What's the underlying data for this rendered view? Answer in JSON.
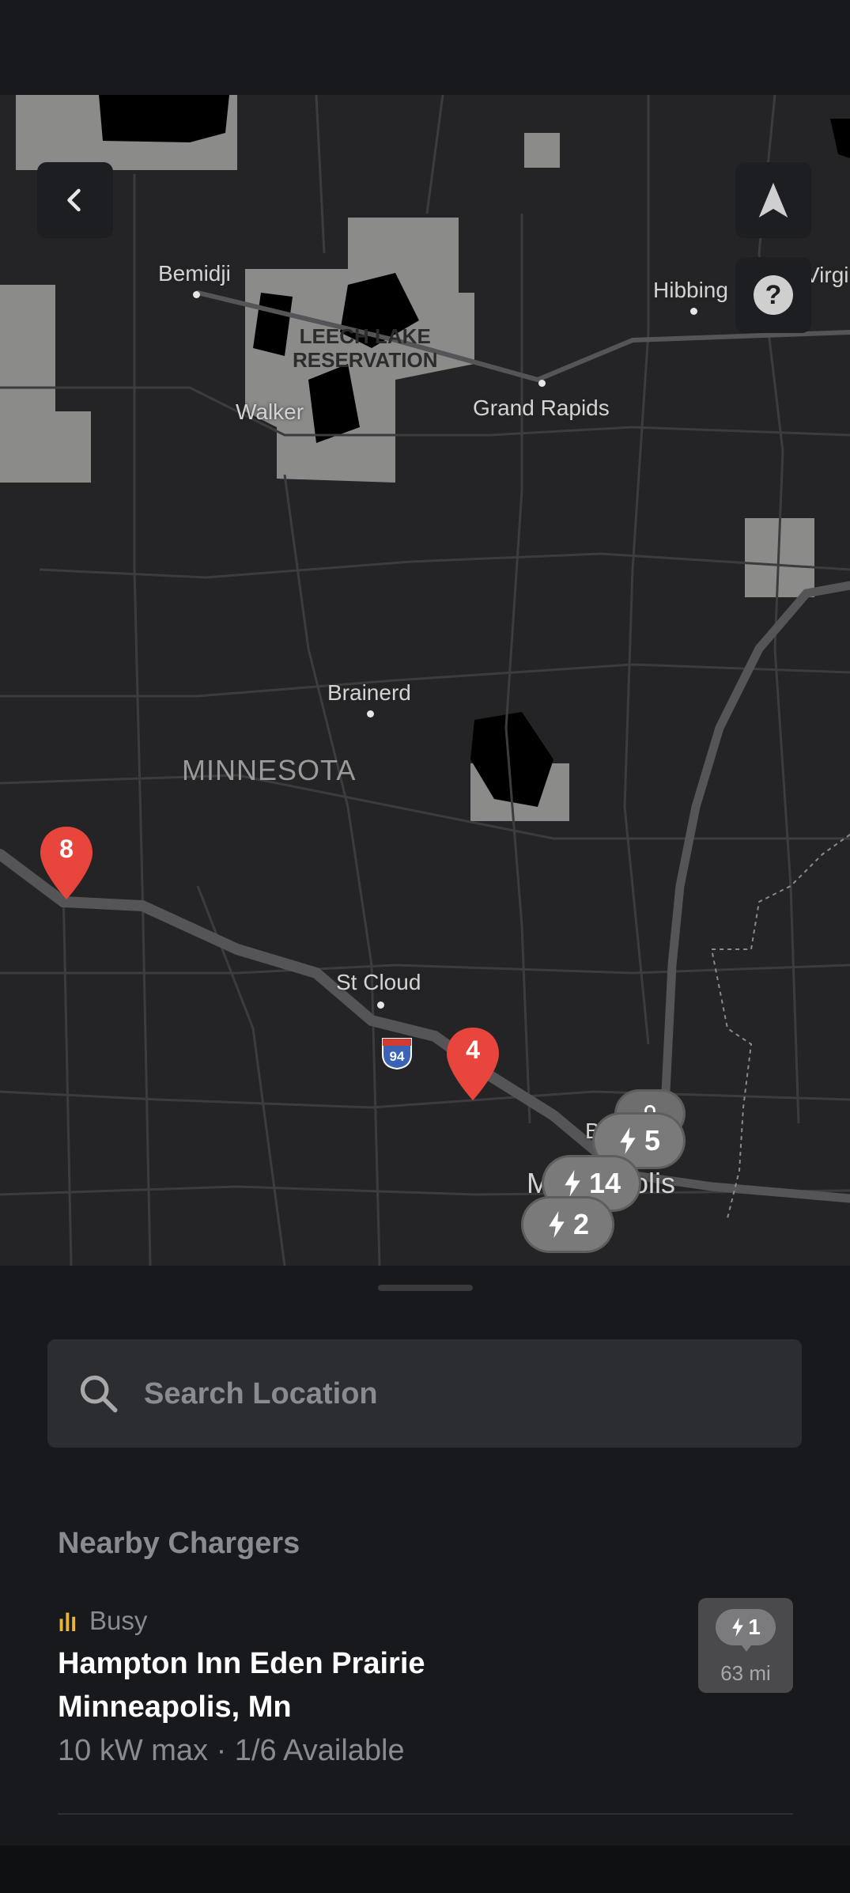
{
  "map": {
    "places": {
      "bemidji": "Bemidji",
      "walker": "Walker",
      "hibbing": "Hibbing",
      "virginia": "Virgi",
      "grand_rapids": "Grand Rapids",
      "brainerd": "Brainerd",
      "st_cloud": "St Cloud",
      "minneapolis_left": "M",
      "minneapolis_right": "olis",
      "blaine_partial": "Bl"
    },
    "state_label": "MINNESOTA",
    "reservation_label": [
      "LEECH LAKE",
      "RESERVATION"
    ],
    "highway_shield": "94",
    "pins": [
      {
        "count": "8",
        "color": "#e8453c"
      },
      {
        "count": "4",
        "color": "#e8453c"
      }
    ],
    "clusters": [
      {
        "count": "5"
      },
      {
        "count": "14"
      },
      {
        "count": "2"
      }
    ],
    "icons": {
      "back": "chevron-left-icon",
      "navigate": "navigation-arrow-icon",
      "help": "question-mark-icon"
    },
    "help_glyph": "?"
  },
  "search": {
    "placeholder": "Search Location"
  },
  "nearby": {
    "title": "Nearby Chargers",
    "chargers": [
      {
        "status": "Busy",
        "status_color": "#e8b53c",
        "name": "Hampton Inn Eden Prairie",
        "city": "Minneapolis, Mn",
        "info": "10 kW max · 1/6 Available",
        "stall_count": "1",
        "distance": "63 mi"
      }
    ]
  }
}
